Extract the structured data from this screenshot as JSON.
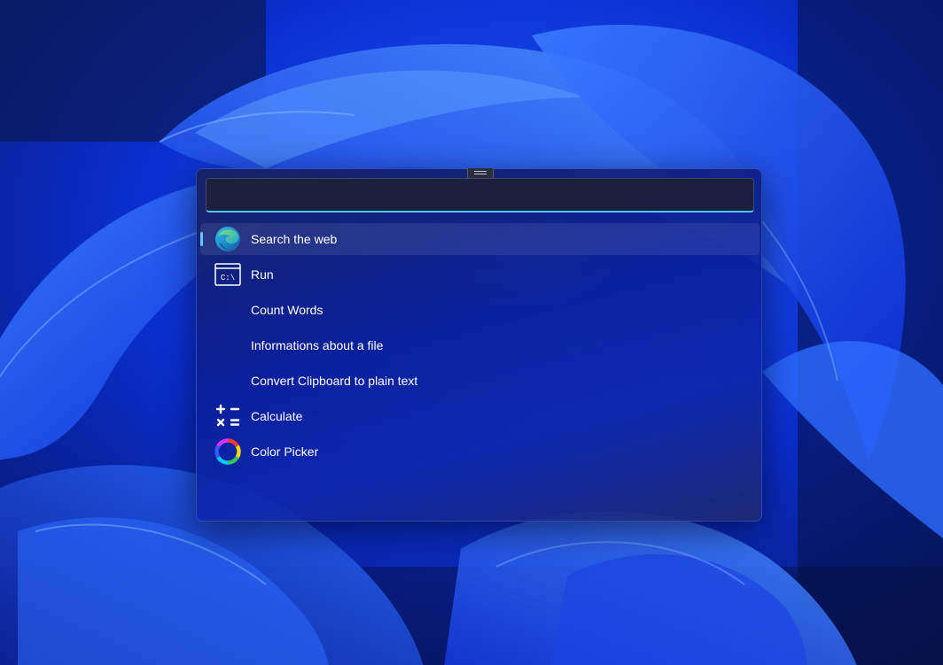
{
  "search": {
    "value": "",
    "placeholder": ""
  },
  "results": [
    {
      "label": "Search the web",
      "icon": "edge-browser-icon",
      "selected": true
    },
    {
      "label": "Run",
      "icon": "command-prompt-icon",
      "selected": false
    },
    {
      "label": "Count Words",
      "icon": "",
      "selected": false
    },
    {
      "label": "Informations about a file",
      "icon": "",
      "selected": false
    },
    {
      "label": "Convert Clipboard to plain text",
      "icon": "",
      "selected": false
    },
    {
      "label": "Calculate",
      "icon": "calculator-icon",
      "selected": false
    },
    {
      "label": "Color Picker",
      "icon": "color-wheel-icon",
      "selected": false
    }
  ],
  "icons": {
    "run_icon_text": "C:\\"
  },
  "colors": {
    "accent": "#4cc2ff",
    "selection_indicator": "#60c8ff",
    "text": "#ffffff"
  }
}
